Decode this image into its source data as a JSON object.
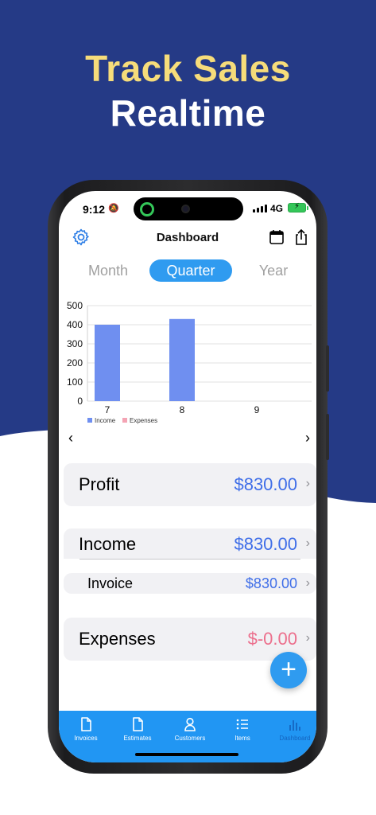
{
  "hero": {
    "line1": "Track Sales",
    "line2": "Realtime"
  },
  "colors": {
    "background": "#253a86",
    "accent": "#2f9bf0",
    "income": "#6f8ff0",
    "expenses": "#f4a4b4",
    "positive": "#3f6ee8",
    "negative": "#ec6f8c",
    "headline": "#f6dc7a"
  },
  "status_bar": {
    "time": "9:12",
    "network": "4G"
  },
  "nav": {
    "title": "Dashboard",
    "left_icon": "gear-icon",
    "right_icons": [
      "calendar-icon",
      "share-icon"
    ]
  },
  "segments": {
    "items": [
      "Month",
      "Quarter",
      "Year"
    ],
    "selected": "Quarter"
  },
  "chart_data": {
    "type": "bar",
    "categories": [
      "7",
      "8",
      "9"
    ],
    "series": [
      {
        "name": "Income",
        "values": [
          400,
          430,
          0
        ]
      },
      {
        "name": "Expenses",
        "values": [
          0,
          0,
          0
        ]
      }
    ],
    "ylim": [
      0,
      500
    ],
    "yticks": [
      "500",
      "400",
      "300",
      "200",
      "100",
      "0"
    ],
    "grid": true,
    "legend_position": "bottom-left"
  },
  "pager": {
    "prev": "‹",
    "next": "›"
  },
  "summary": {
    "profit": {
      "label": "Profit",
      "value": "$830.00"
    },
    "income": {
      "label": "Income",
      "value": "$830.00"
    },
    "invoice": {
      "label": "Invoice",
      "value": "$830.00"
    },
    "expenses": {
      "label": "Expenses",
      "value": "$-0.00"
    }
  },
  "fab": {
    "label": "+"
  },
  "tabbar": {
    "items": [
      {
        "label": "Invoices",
        "icon": "document-icon"
      },
      {
        "label": "Estimates",
        "icon": "document-icon"
      },
      {
        "label": "Customers",
        "icon": "person-icon"
      },
      {
        "label": "Items",
        "icon": "list-icon"
      },
      {
        "label": "Dashboard",
        "icon": "bar-chart-icon"
      }
    ],
    "selected": "Dashboard"
  }
}
